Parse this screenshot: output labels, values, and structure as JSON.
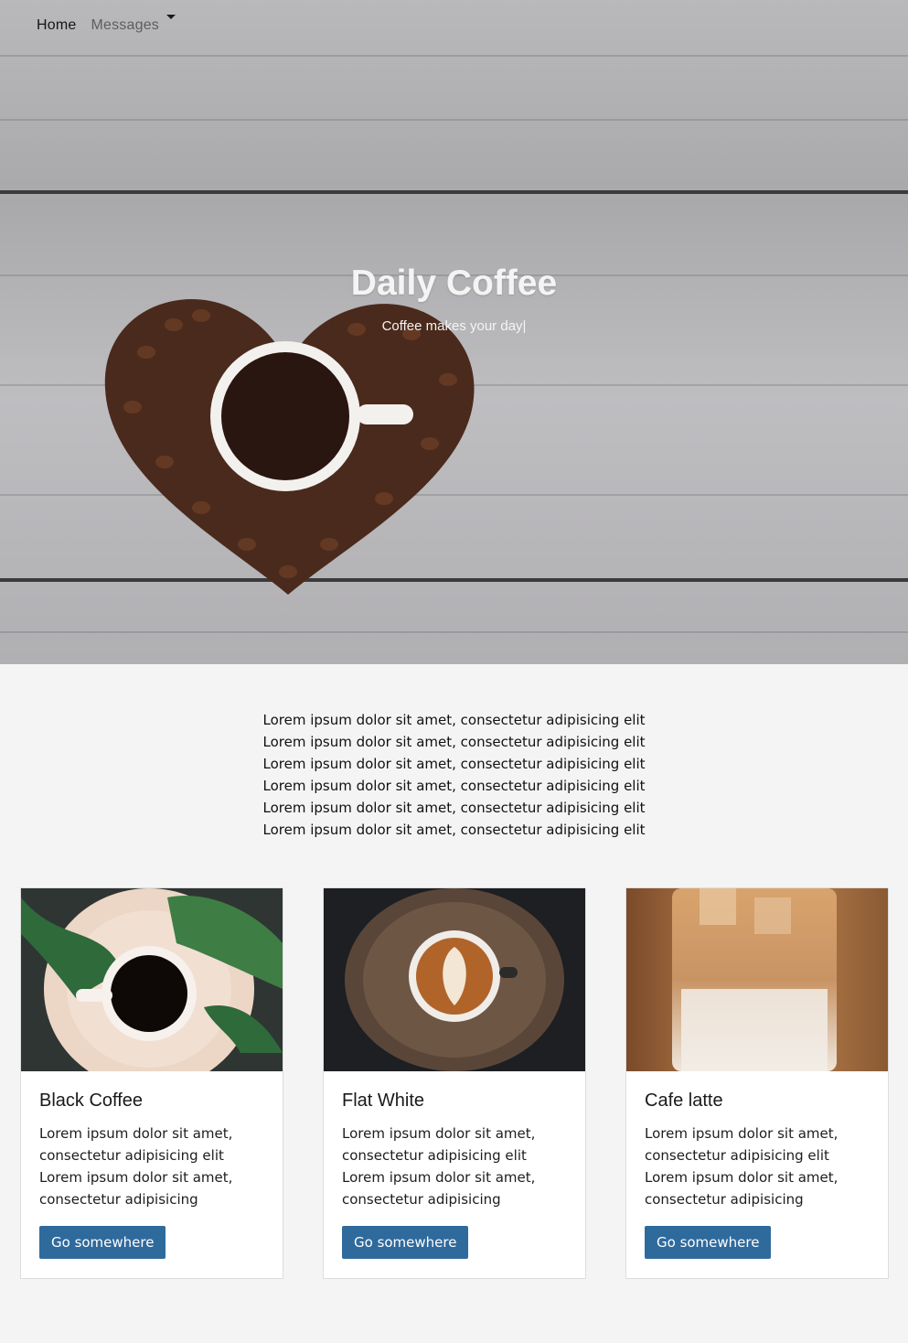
{
  "nav": {
    "home_label": "Home",
    "messages_label": "Messages"
  },
  "hero": {
    "title": "Daily Coffee",
    "subtitle": "Coffee makes your day|"
  },
  "intro": {
    "lines": [
      "Lorem ipsum dolor sit amet, consectetur adipisicing elit",
      "Lorem ipsum dolor sit amet, consectetur adipisicing elit",
      "Lorem ipsum dolor sit amet, consectetur adipisicing elit",
      "Lorem ipsum dolor sit amet, consectetur adipisicing elit",
      "Lorem ipsum dolor sit amet, consectetur adipisicing elit",
      "Lorem ipsum dolor sit amet, consectetur adipisicing elit"
    ]
  },
  "cards": [
    {
      "title": "Black Coffee",
      "text": "Lorem ipsum dolor sit amet, consectetur adipisicing elit Lorem ipsum dolor sit amet, consectetur adipisicing",
      "button": "Go somewhere"
    },
    {
      "title": "Flat White",
      "text": "Lorem ipsum dolor sit amet, consectetur adipisicing elit Lorem ipsum dolor sit amet, consectetur adipisicing",
      "button": "Go somewhere"
    },
    {
      "title": "Cafe latte",
      "text": "Lorem ipsum dolor sit amet, consectetur adipisicing elit Lorem ipsum dolor sit amet, consectetur adipisicing",
      "button": "Go somewhere"
    }
  ],
  "colors": {
    "button": "#2f6a9d",
    "page_background": "#f4f4f4"
  }
}
